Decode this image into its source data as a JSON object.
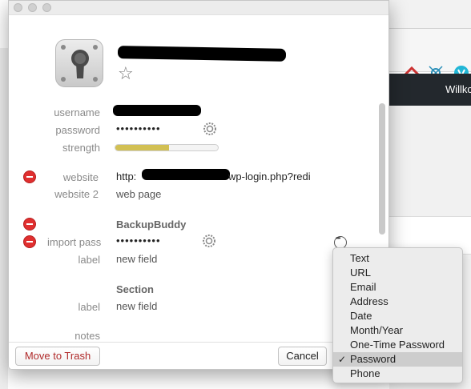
{
  "background": {
    "nav_label": "Willkc"
  },
  "window": {
    "fields": [
      {
        "label": "username",
        "value_redacted": true
      },
      {
        "label": "password",
        "value": "••••••••••"
      },
      {
        "label": "strength",
        "strength_level": 0.52
      }
    ],
    "website_rows": [
      {
        "label": "website",
        "value_prefix": "http:",
        "value_suffix": "wp-login.php?redi"
      },
      {
        "label": "website 2",
        "value": "web page"
      }
    ],
    "section_backupbuddy": {
      "title": "BackupBuddy",
      "rows": [
        {
          "label": "import pass",
          "value": "••••••••••"
        },
        {
          "label": "label",
          "value": "new field"
        }
      ]
    },
    "section_two": {
      "title": "Section",
      "rows": [
        {
          "label": "label",
          "value": "new field"
        }
      ]
    },
    "notes_label": "notes",
    "buttons": {
      "trash": "Move to Trash",
      "cancel": "Cancel"
    }
  },
  "menu": {
    "items": [
      "Text",
      "URL",
      "Email",
      "Address",
      "Date",
      "Month/Year",
      "One-Time Password",
      "Password",
      "Phone"
    ],
    "selected": "Password",
    "check_glyph": "✓"
  },
  "colors": {
    "remove": "#e02f2f",
    "strength": "#d2c053",
    "trash_text": "#b02a2a"
  }
}
